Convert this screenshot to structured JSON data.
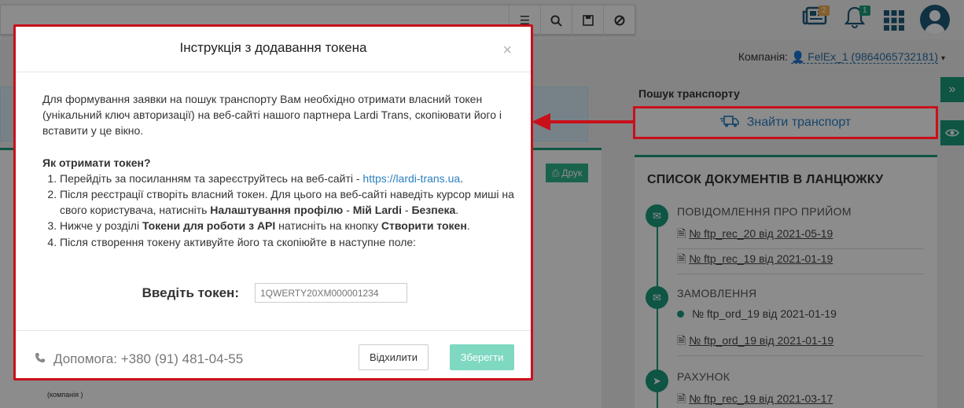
{
  "header": {
    "news_badge": "2",
    "notifications_badge": "1"
  },
  "company": {
    "label": "Компанія:",
    "value": "FelEx_1 (9864065732181)"
  },
  "right_panel": {
    "search_title": "Пошук транспорту",
    "find_transport_label": "Знайти транспорт",
    "docs_title": "СПИСОК ДОКУМЕНТІВ В ЛАНЦЮЖКУ",
    "groups": [
      {
        "title": "ПОВІДОМЛЕННЯ ПРО ПРИЙОМ",
        "items": [
          "№ ftp_rec_20 від 2021-05-19",
          "№ ftp_rec_19 від 2021-01-19"
        ]
      },
      {
        "title": "ЗАМОВЛЕННЯ",
        "items": [
          "№ ftp_ord_19 від 2021-01-19",
          "№ ftp_ord_19 від 2021-01-19"
        ]
      },
      {
        "title": "РАХУНОК",
        "items": [
          "№ ftp_rec_19 від 2021-03-17"
        ]
      }
    ]
  },
  "left_panel": {
    "print_label": "Друк",
    "company_caption": "(компанія )"
  },
  "modal": {
    "title": "Інструкція з додавання токена",
    "close": "×",
    "intro": "Для формування заявки на пошук транспорту Вам необхідно отримати власний токен (унікальний ключ авторизації) на веб-сайті нашого партнера Lardi Trans, скопіювати його і вставити у це вікно.",
    "howto": "Як отримати токен?",
    "step1_text": "Перейдіть за посиланням та зареєструйтесь на веб-сайті - ",
    "step1_link": "https://lardi-trans.ua",
    "step1_end": ".",
    "step2_text": "Після реєстрації створіть власний токен. Для цього на веб-сайті наведіть курсор миші на свого користувача, натисніть ",
    "step2_bold1": "Налаштування профілю",
    "step2_sep": " - ",
    "step2_bold2": "Мій Lardi",
    "step2_sep2": " - ",
    "step2_bold3": "Безпека",
    "step2_end": ".",
    "step3_text": "Нижче у розділі ",
    "step3_bold1": "Токени для роботи з API",
    "step3_mid": " натисніть на кнопку ",
    "step3_bold2": "Створити токен",
    "step3_end": ".",
    "step4_text": "Після створення токену активуйте його та скопіюйте в наступне поле:",
    "token_label": "Введіть токен:",
    "token_placeholder": "1QWERTY20XM000001234",
    "help": "Допомога: +380 (91) 481-04-55",
    "cancel_label": "Відхилити",
    "save_label": "Зберегти"
  },
  "colors": {
    "accent": "#1a9b7d",
    "highlight": "#c8101b",
    "link": "#2a7fc1"
  }
}
